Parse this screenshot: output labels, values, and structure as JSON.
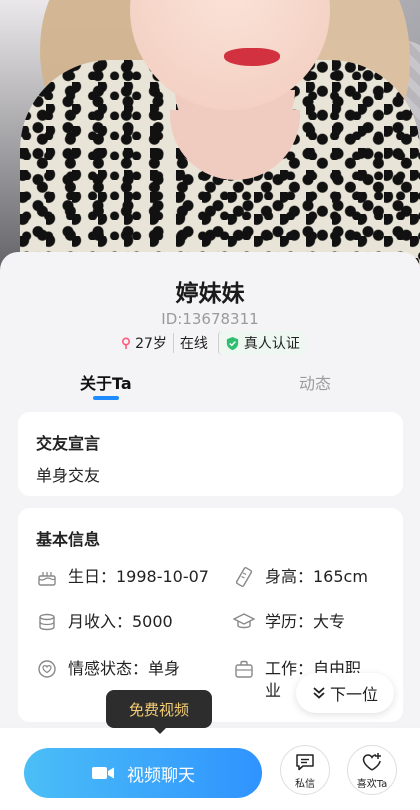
{
  "profile": {
    "name": "婷妹妹",
    "id_text": "ID:13678311",
    "age": "27岁",
    "status": "在线",
    "verified": "真人认证"
  },
  "tabs": {
    "about": "关于Ta",
    "moments": "动态"
  },
  "declaration": {
    "title": "交友宣言",
    "text": "单身交友"
  },
  "basic_info": {
    "title": "基本信息",
    "birthday": "生日：1998-10-07",
    "height": "身高：165cm",
    "income": "月收入：5000",
    "education": "学历：大专",
    "relationship": "情感状态：单身",
    "job_line1": "工作：自由职",
    "job_line2": "业"
  },
  "actions": {
    "next": "下一位",
    "free_video_tip": "免费视频",
    "video_chat": "视频聊天",
    "message": "私信",
    "like": "喜欢Ta"
  },
  "colors": {
    "accent": "#1e8cff",
    "verified_green": "#2fbf71",
    "tooltip_text": "#f4cc73"
  }
}
